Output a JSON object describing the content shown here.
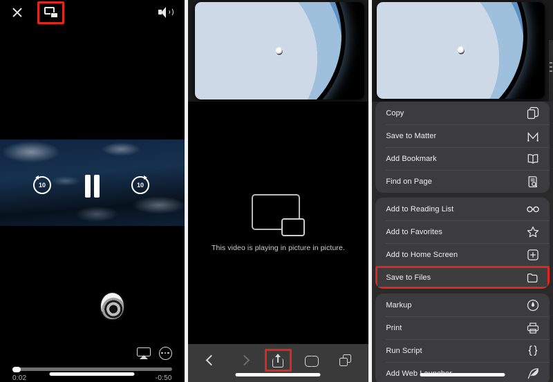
{
  "meta": {
    "accent_highlight": "#e1261c",
    "sheet_bg": "#3c3c3e",
    "panel_divider": "#f4f4f4"
  },
  "panel1": {
    "name": "fullscreen-video-player",
    "top_bar": {
      "close_icon": "close-icon",
      "pip_icon": "picture-in-picture-icon",
      "volume_icon": "volume-icon",
      "highlighted": "picture-in-picture-button"
    },
    "playback": {
      "skip_back_label": "10",
      "skip_forward_label": "10",
      "pause_icon": "pause-icon"
    },
    "bottom_bar": {
      "airplay_icon": "airplay-icon",
      "more_icon": "more-options-icon",
      "current_time": "0:02",
      "remaining_time": "-0:50",
      "progress_percent": 3
    }
  },
  "panel2": {
    "name": "safari-picture-in-picture",
    "pip_message": "This video is playing in picture in picture.",
    "pip_glyph": "picture-in-picture-glyph",
    "toolbar": {
      "back_icon": "chevron-left-icon",
      "forward_icon": "chevron-right-icon",
      "share_icon": "share-icon",
      "bookmarks_icon": "book-icon",
      "tabs_icon": "tabs-icon",
      "highlighted": "share-button"
    }
  },
  "panel3": {
    "name": "share-sheet-menu",
    "highlighted_item": "Save to Files",
    "groups": [
      {
        "items": [
          {
            "label": "Copy",
            "icon": "copy-icon"
          },
          {
            "label": "Save to Matter",
            "icon": "matter-icon"
          },
          {
            "label": "Add Bookmark",
            "icon": "book-icon"
          },
          {
            "label": "Find on Page",
            "icon": "find-on-page-icon"
          }
        ]
      },
      {
        "items": [
          {
            "label": "Add to Reading List",
            "icon": "glasses-icon"
          },
          {
            "label": "Add to Favorites",
            "icon": "star-icon"
          },
          {
            "label": "Add to Home Screen",
            "icon": "plus-square-icon"
          },
          {
            "label": "Save to Files",
            "icon": "folder-icon"
          }
        ]
      },
      {
        "items": [
          {
            "label": "Markup",
            "icon": "markup-icon"
          },
          {
            "label": "Print",
            "icon": "printer-icon"
          },
          {
            "label": "Run Script",
            "icon": "braces-icon"
          },
          {
            "label": "Add Web Launcher",
            "icon": "feather-icon"
          }
        ]
      }
    ]
  }
}
